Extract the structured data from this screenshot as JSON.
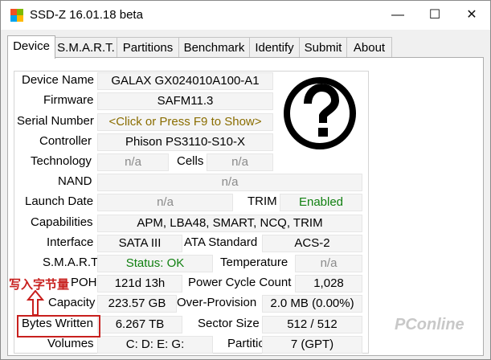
{
  "window": {
    "title": "SSD-Z 16.01.18 beta",
    "minimize": "—",
    "maximize": "☐",
    "close": "✕"
  },
  "tabs": [
    "Device",
    "S.M.A.R.T.",
    "Partitions",
    "Benchmark",
    "Identify",
    "Submit",
    "About"
  ],
  "active_tab": "Device",
  "fields": {
    "device_name": {
      "label": "Device Name",
      "value": "GALAX GX024010A100-A1"
    },
    "firmware": {
      "label": "Firmware",
      "value": "SAFM11.3"
    },
    "serial_number": {
      "label": "Serial Number",
      "value": "<Click or Press F9 to Show>"
    },
    "controller": {
      "label": "Controller",
      "value": "Phison PS3110-S10-X"
    },
    "technology": {
      "label": "Technology",
      "value": "n/a"
    },
    "cells": {
      "label": "Cells",
      "value": "n/a"
    },
    "nand": {
      "label": "NAND",
      "value": "n/a"
    },
    "launch_date": {
      "label": "Launch Date",
      "value": "n/a"
    },
    "trim": {
      "label": "TRIM",
      "value": "Enabled"
    },
    "capabilities": {
      "label": "Capabilities",
      "value": "APM, LBA48, SMART, NCQ, TRIM"
    },
    "interface": {
      "label": "Interface",
      "value": "SATA III"
    },
    "ata_standard": {
      "label": "ATA Standard",
      "value": "ACS-2"
    },
    "smart": {
      "label": "S.M.A.R.T.",
      "value": "Status: OK"
    },
    "temperature": {
      "label": "Temperature",
      "value": "n/a"
    },
    "poh": {
      "label": "POH",
      "value": "121d 13h"
    },
    "power_cycle_count": {
      "label": "Power Cycle Count",
      "value": "1,028"
    },
    "capacity": {
      "label": "Capacity",
      "value": "223.57 GB"
    },
    "over_provision": {
      "label": "Over-Provision",
      "value": "2.0 MB (0.00%)"
    },
    "bytes_written": {
      "label": "Bytes Written",
      "value": "6.267 TB"
    },
    "sector_size": {
      "label": "Sector Size",
      "value": "512 / 512"
    },
    "volumes": {
      "label": "Volumes",
      "value": "C:  D:  E:  G:"
    },
    "partitions": {
      "label": "Partitions",
      "value": "7 (GPT)"
    }
  },
  "annotation": "写入字节量",
  "watermark": "PConline",
  "icons": {
    "device_image": "question-mark-icon",
    "app": "app-icon"
  },
  "colors": {
    "status_ok": "#118011",
    "enabled": "#118011",
    "serial_hint": "#8a6d00",
    "annotation": "#c8201e"
  }
}
